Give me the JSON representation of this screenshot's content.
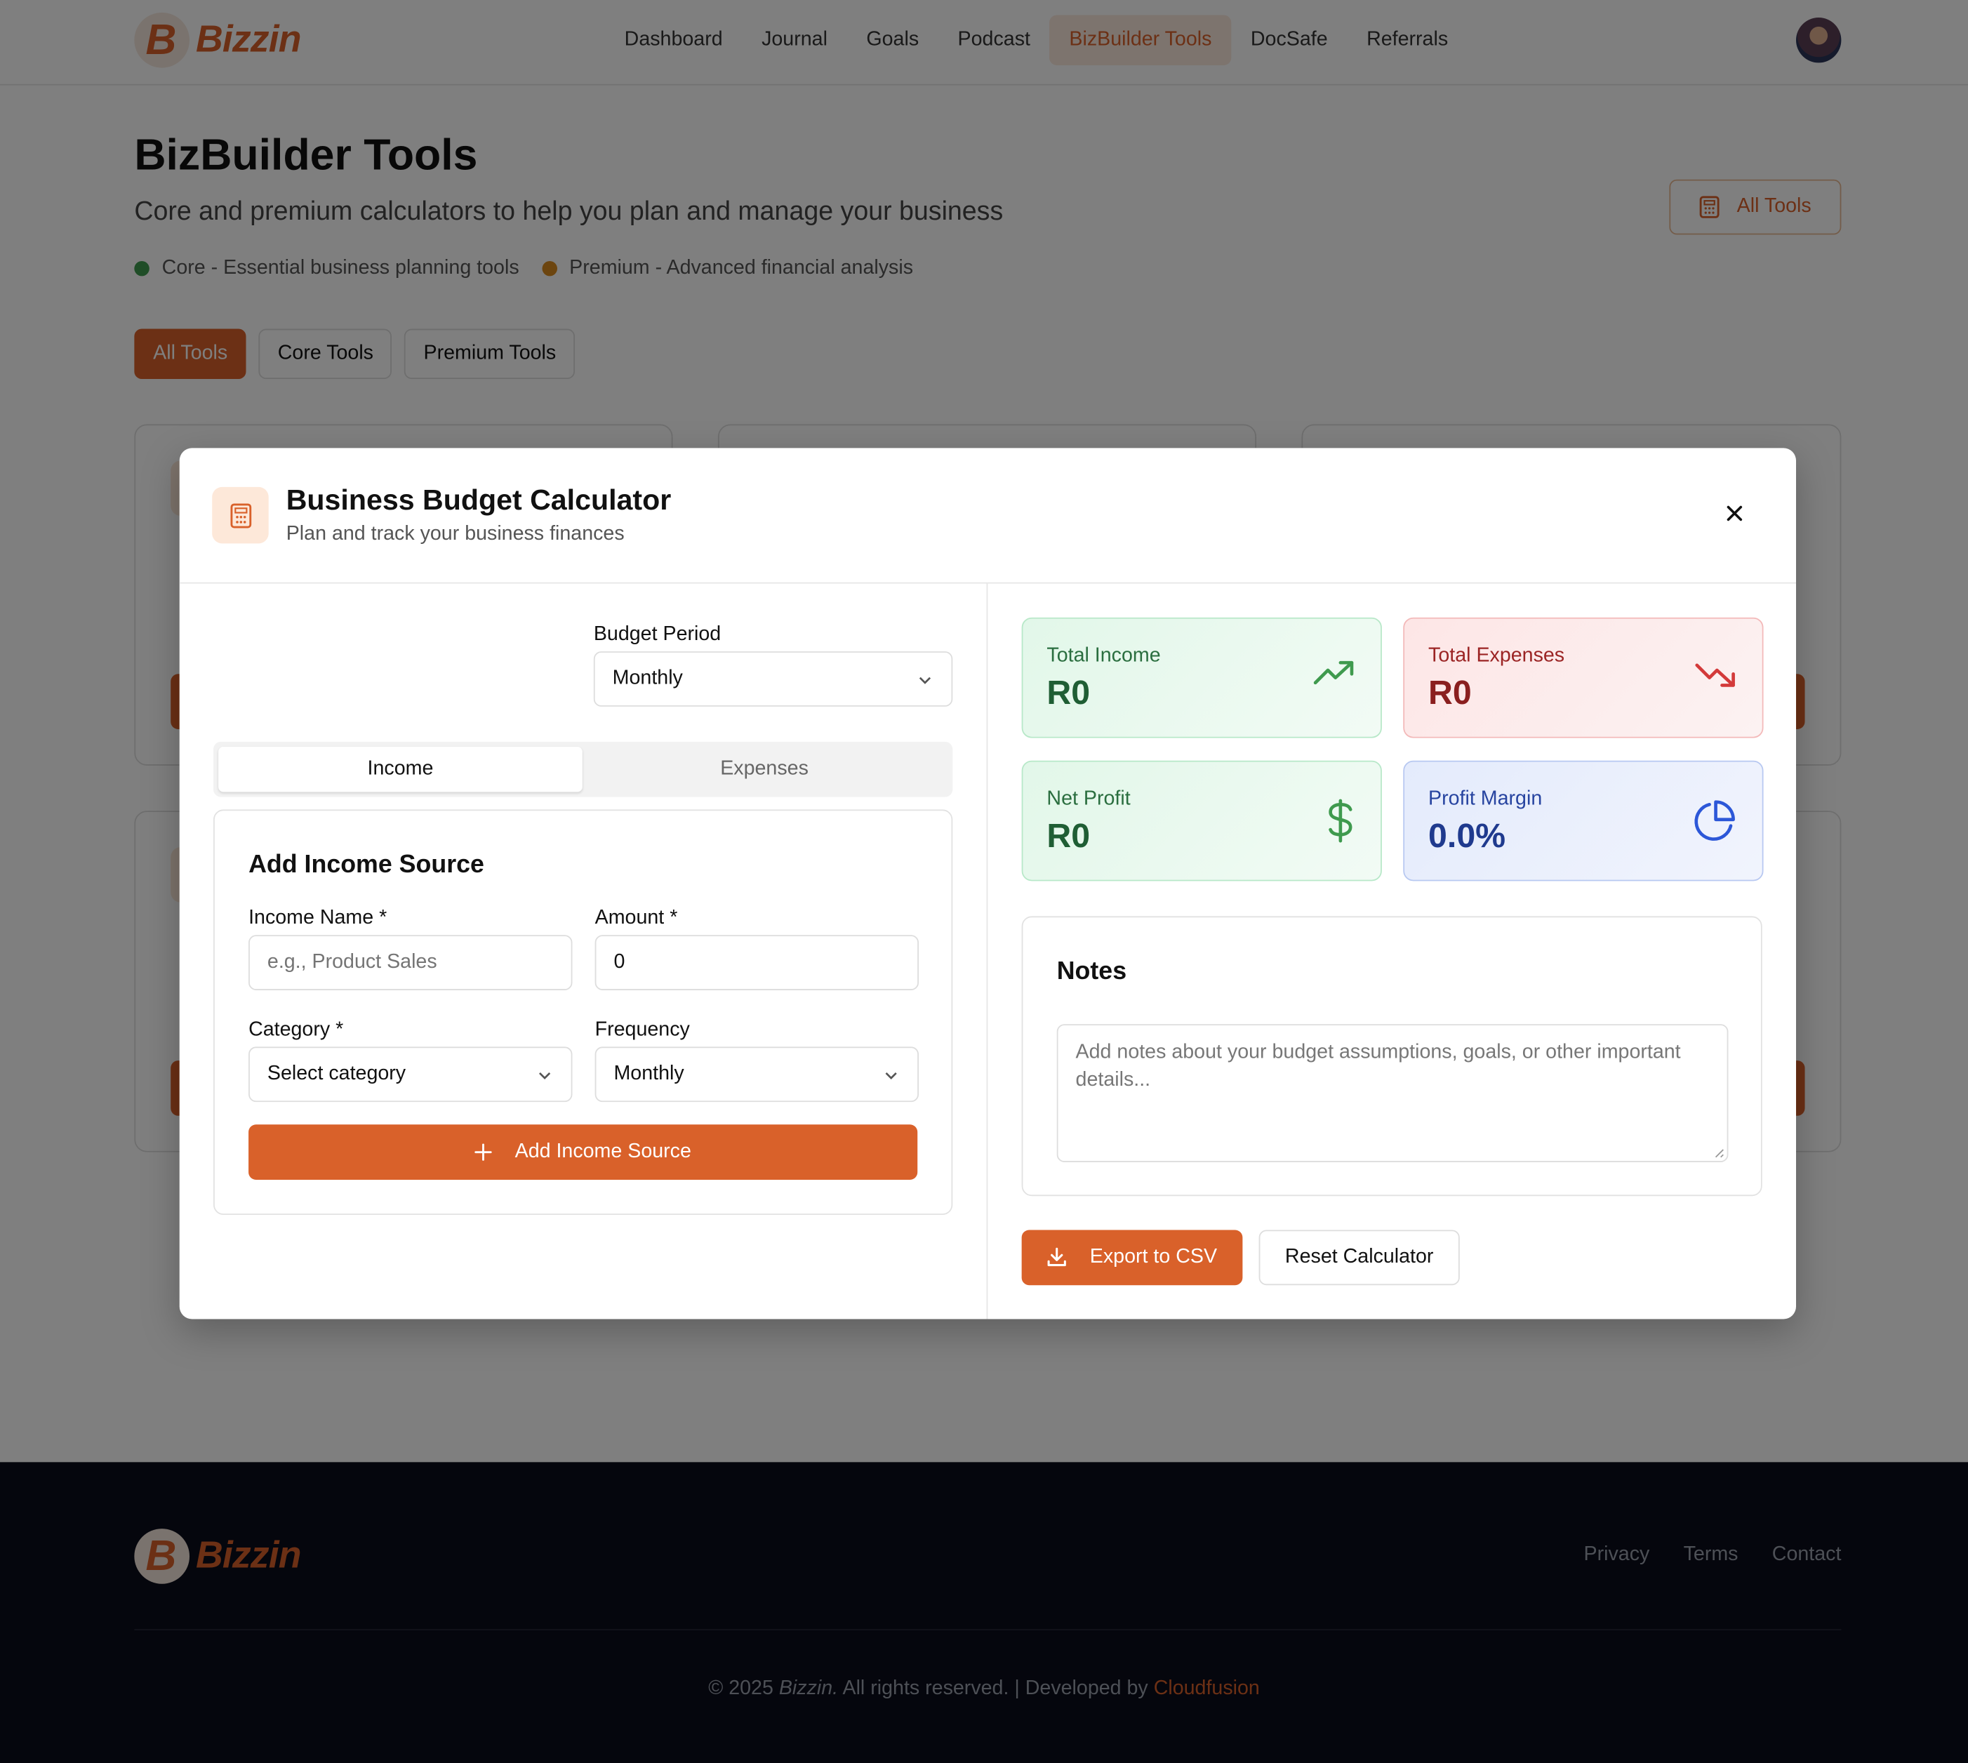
{
  "brand": {
    "name": "Bizzin",
    "mark": "B"
  },
  "nav": {
    "items": [
      {
        "label": "Dashboard"
      },
      {
        "label": "Journal"
      },
      {
        "label": "Goals"
      },
      {
        "label": "Podcast"
      },
      {
        "label": "BizBuilder Tools",
        "active": true
      },
      {
        "label": "DocSafe"
      },
      {
        "label": "Referrals"
      }
    ]
  },
  "page": {
    "title": "BizBuilder Tools",
    "subtitle": "Core and premium calculators to help you plan and manage your business",
    "legend": [
      {
        "label": "Core - Essential business planning tools",
        "color": "#3f9a4e"
      },
      {
        "label": "Premium - Advanced financial analysis",
        "color": "#d98a1f"
      }
    ],
    "all_tools_button": "All Tools",
    "filters": [
      "All Tools",
      "Core Tools",
      "Premium Tools"
    ]
  },
  "modal": {
    "title": "Business Budget Calculator",
    "subtitle": "Plan and track your business finances",
    "budget_period": {
      "label": "Budget Period",
      "value": "Monthly"
    },
    "tabs": [
      {
        "label": "Income",
        "active": true
      },
      {
        "label": "Expenses"
      }
    ],
    "form": {
      "title": "Add Income Source",
      "income_name": {
        "label": "Income Name *",
        "placeholder": "e.g., Product Sales"
      },
      "amount": {
        "label": "Amount *",
        "value": "0"
      },
      "category": {
        "label": "Category *",
        "value": "Select category"
      },
      "frequency": {
        "label": "Frequency",
        "value": "Monthly"
      },
      "submit": "Add Income Source"
    },
    "stats": {
      "total_income": {
        "label": "Total Income",
        "value": "R0"
      },
      "total_expenses": {
        "label": "Total Expenses",
        "value": "R0"
      },
      "net_profit": {
        "label": "Net Profit",
        "value": "R0"
      },
      "profit_margin": {
        "label": "Profit Margin",
        "value": "0.0%"
      }
    },
    "notes": {
      "title": "Notes",
      "placeholder": "Add notes about your budget assumptions, goals, or other important details..."
    },
    "export_button": "Export to CSV",
    "reset_button": "Reset Calculator"
  },
  "footer": {
    "links": [
      "Privacy",
      "Terms",
      "Contact"
    ],
    "copyright_prefix": "© 2025",
    "copyright_brand": "Bizzin.",
    "copyright_rest": "All rights reserved. | Developed by",
    "developer": "Cloudfusion"
  },
  "colors": {
    "accent": "#d9612a",
    "footer_bg": "#0b0c1a"
  }
}
